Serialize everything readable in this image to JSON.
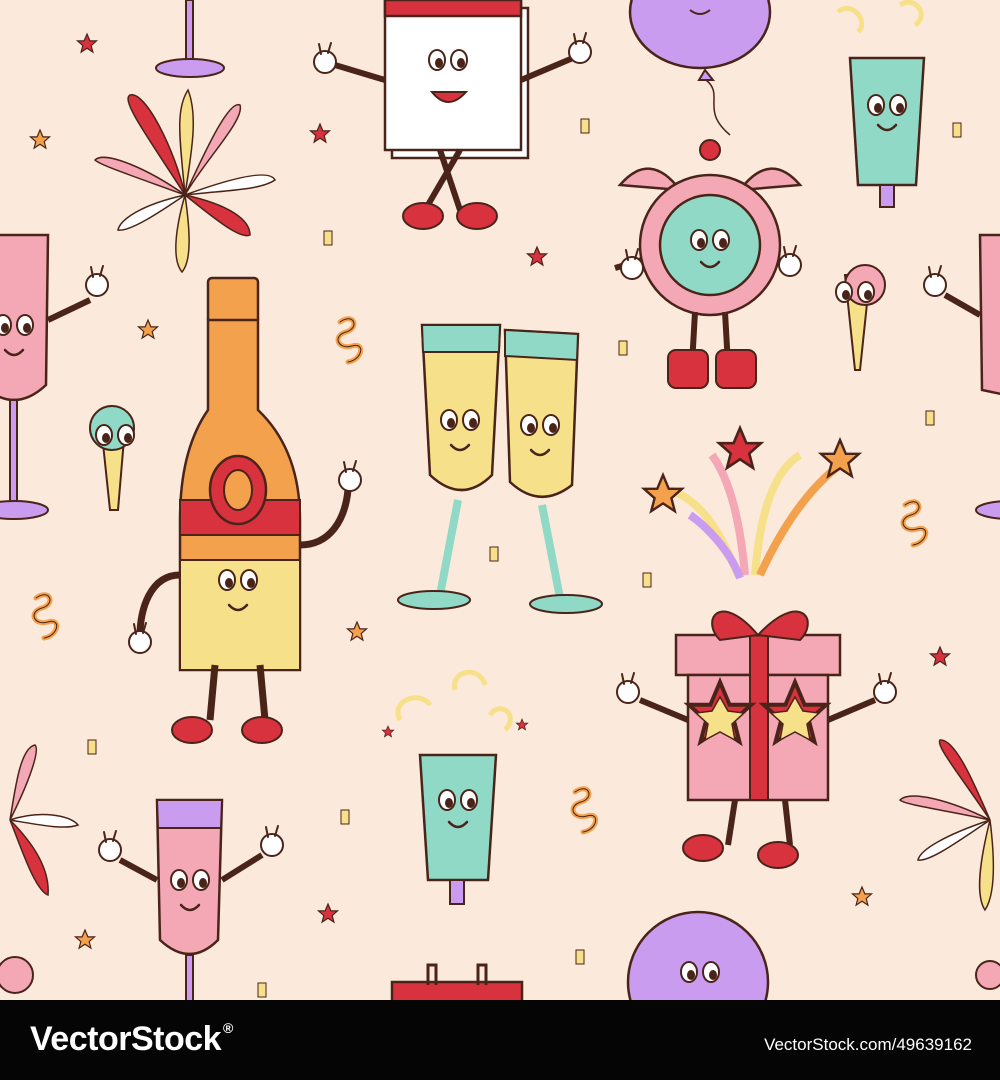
{
  "image": {
    "description_tags": [
      "new-year-party",
      "champagne-bottle",
      "toasting-glasses",
      "alarm-clock",
      "calendar",
      "gift-box",
      "balloon",
      "party-popper",
      "fireworks",
      "confetti"
    ],
    "colors": {
      "background": "#fbe9dc",
      "outline": "#4a2419",
      "red": "#d8323f",
      "pink": "#f4a7b5",
      "orange": "#f3a14c",
      "yellow": "#f7e08a",
      "mint": "#8fd9c6",
      "lilac": "#c99cf0",
      "white": "#ffffff"
    }
  },
  "footer": {
    "brand": "VectorStock",
    "registered_mark": "®",
    "image_code": "VectorStock.com/49639162"
  }
}
